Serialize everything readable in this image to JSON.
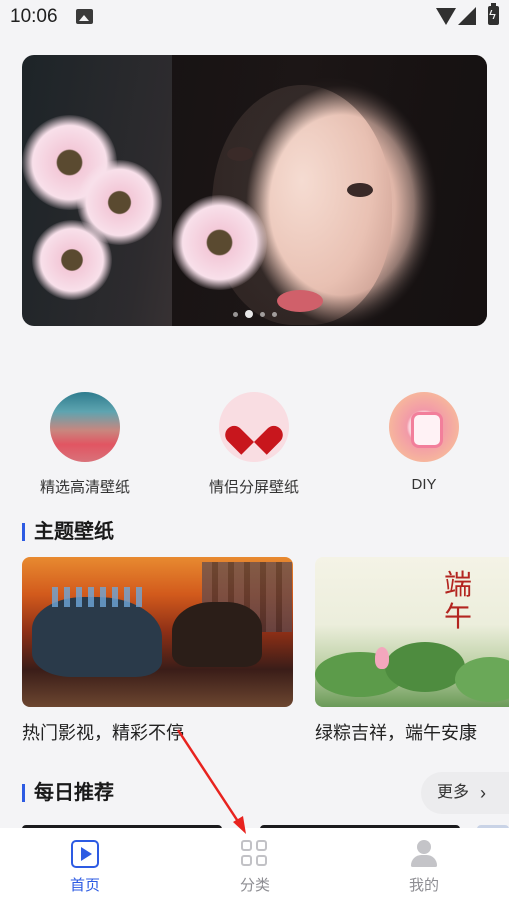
{
  "status_bar": {
    "time": "10:06",
    "icons": [
      "image-icon",
      "wifi-icon",
      "signal-icon",
      "battery-charging-icon"
    ]
  },
  "banner": {
    "slide_count": 4,
    "active_slide": 2
  },
  "categories": [
    {
      "label": "精选高清壁纸",
      "icon": "ocean-thumbnail-icon"
    },
    {
      "label": "情侣分屏壁纸",
      "icon": "heart-icon"
    },
    {
      "label": "DIY",
      "icon": "diy-icon"
    }
  ],
  "theme_section": {
    "title": "主题壁纸",
    "cards": [
      {
        "caption": "热门影视，精彩不停"
      },
      {
        "caption": "绿粽吉祥，端午安康",
        "art_text": "端午"
      }
    ]
  },
  "daily_section": {
    "title": "每日推荐",
    "more_label": "更多"
  },
  "bottom_nav": {
    "items": [
      {
        "label": "首页",
        "icon": "play-icon",
        "active": true
      },
      {
        "label": "分类",
        "icon": "grid-icon",
        "active": false
      },
      {
        "label": "我的",
        "icon": "user-icon",
        "active": false
      }
    ]
  },
  "colors": {
    "accent": "#2d5be3",
    "inactive": "#8e8e93",
    "annotation_arrow": "#e8231f"
  }
}
